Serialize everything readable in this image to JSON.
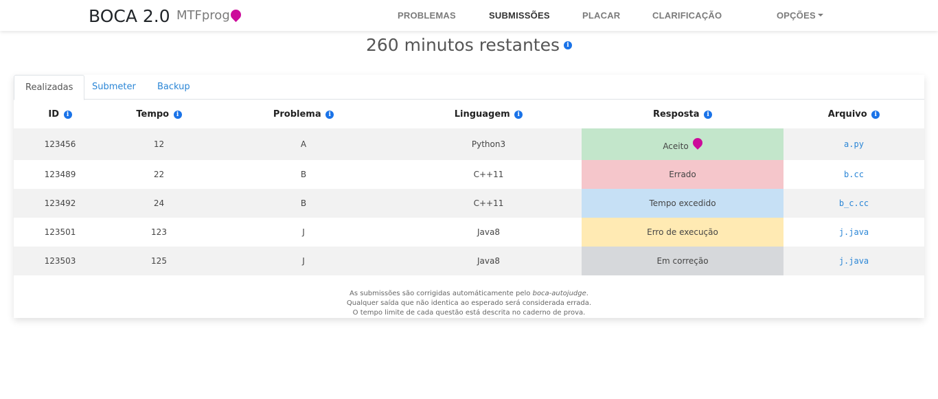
{
  "nav": {
    "brand": "BOCA 2.0",
    "contest": "MTFprog",
    "links": [
      "PROBLEMAS",
      "SUBMISSÕES",
      "PLACAR",
      "CLARIFICAÇÃO",
      "OPÇÕES"
    ],
    "active": "SUBMISSÕES"
  },
  "timer": {
    "text": "260 minutos restantes"
  },
  "tabs": [
    "Realizadas",
    "Submeter",
    "Backup"
  ],
  "table": {
    "headers": [
      "ID",
      "Tempo",
      "Problema",
      "Linguagem",
      "Resposta",
      "Arquivo"
    ],
    "rows": [
      {
        "id": "123456",
        "tempo": "12",
        "problema": "A",
        "linguagem": "Python3",
        "resposta": "Aceito",
        "arquivo": "a.py",
        "color": "#c3e6cb"
      },
      {
        "id": "123489",
        "tempo": "22",
        "problema": "B",
        "linguagem": "C++11",
        "resposta": "Errado",
        "arquivo": "b.cc",
        "color": "#f5c6cb"
      },
      {
        "id": "123492",
        "tempo": "24",
        "problema": "B",
        "linguagem": "C++11",
        "resposta": "Tempo excedido",
        "arquivo": "b_c.cc",
        "color": "#c6e0f5"
      },
      {
        "id": "123501",
        "tempo": "123",
        "problema": "J",
        "linguagem": "Java8",
        "resposta": "Erro de execução",
        "arquivo": "j.java",
        "color": "#ffeab3"
      },
      {
        "id": "123503",
        "tempo": "125",
        "problema": "J",
        "linguagem": "Java8",
        "resposta": "Em correção",
        "arquivo": "j.java",
        "color": "#d6d8db"
      }
    ]
  },
  "footer": {
    "line1_pre": "As submissões são corrigidas automáticamente pelo ",
    "line1_em": "boca-autojudge",
    "line1_post": ".",
    "line2": "Qualquer saída que não identica ao esperado será considerada errada.",
    "line3": "O tempo limite de cada questão está descrita no caderno de prova."
  },
  "colors": {
    "balloon": "#cc0a9a",
    "link": "#2b86d6",
    "info": "#1a73e8"
  },
  "icons": {
    "info": "info-icon",
    "balloon": "balloon-icon",
    "caret": "caret-down-icon"
  }
}
